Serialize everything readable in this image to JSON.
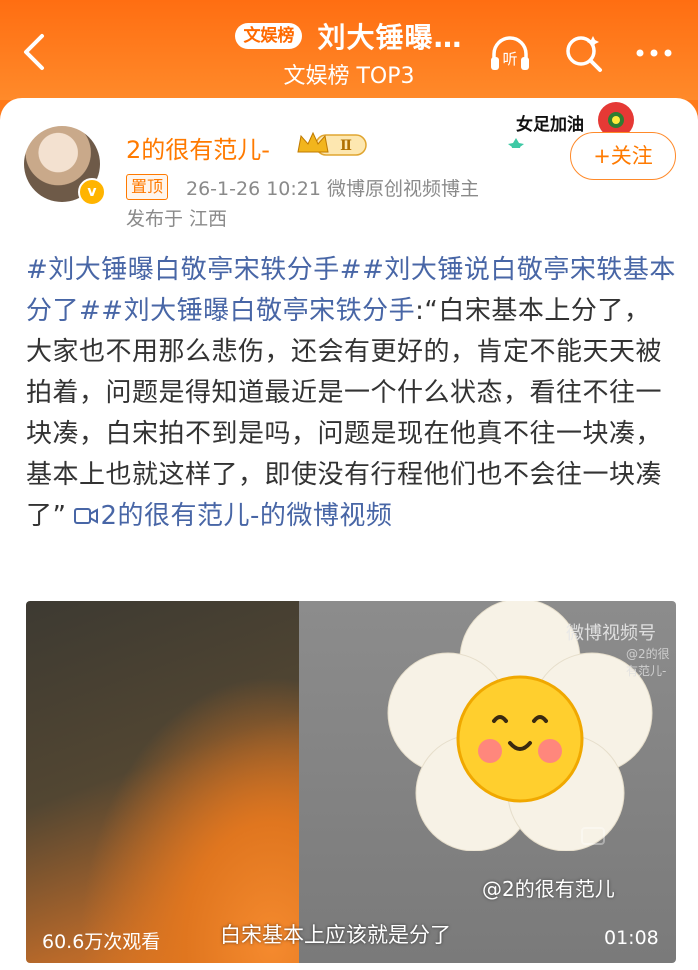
{
  "header": {
    "badge": "文娱榜",
    "title": "刘大锤曝…",
    "subtitle": "文娱榜 TOP3",
    "icons": [
      "back-arrow-icon",
      "listen-headphones-icon",
      "search-icon",
      "more-icon"
    ],
    "listen_label": "听",
    "brand_color": "#ff7a1a"
  },
  "post": {
    "username": "2的很有范儿-",
    "level_badge": "Ⅱ",
    "pinned_label": "置顶",
    "meta": "26-1-26 10:21  微博原创视频博主",
    "location": "发布于 江西",
    "follow_label": "+关注",
    "deco_text": "女足加油",
    "text_parts": {
      "topic1": "#刘大锤曝白敬亭宋轶分手#",
      "topic2": "#刘大锤说白敬亭宋轶基本分了#",
      "topic3": "#刘大锤曝白敬亭宋铁分手",
      "body": ":“白宋基本上分了，大家也不用那么悲伤，还会有更好的，肯定不能天天被拍着，问题是得知道最近是一个什么状态，看往不往一块凑，白宋拍不到是吗，问题是现在他真不往一块凑，基本上也就这样了，即使没有行程他们也不会往一块凑了”",
      "video_link": "2的很有范儿-的微博视频"
    }
  },
  "video": {
    "watermark": "微博视频号",
    "watermark_user": "@2的很有范儿-",
    "at_user": "@2的很有范儿",
    "views": "60.6万次观看",
    "caption": "白宋基本上应该就是分了",
    "duration": "01:08"
  }
}
